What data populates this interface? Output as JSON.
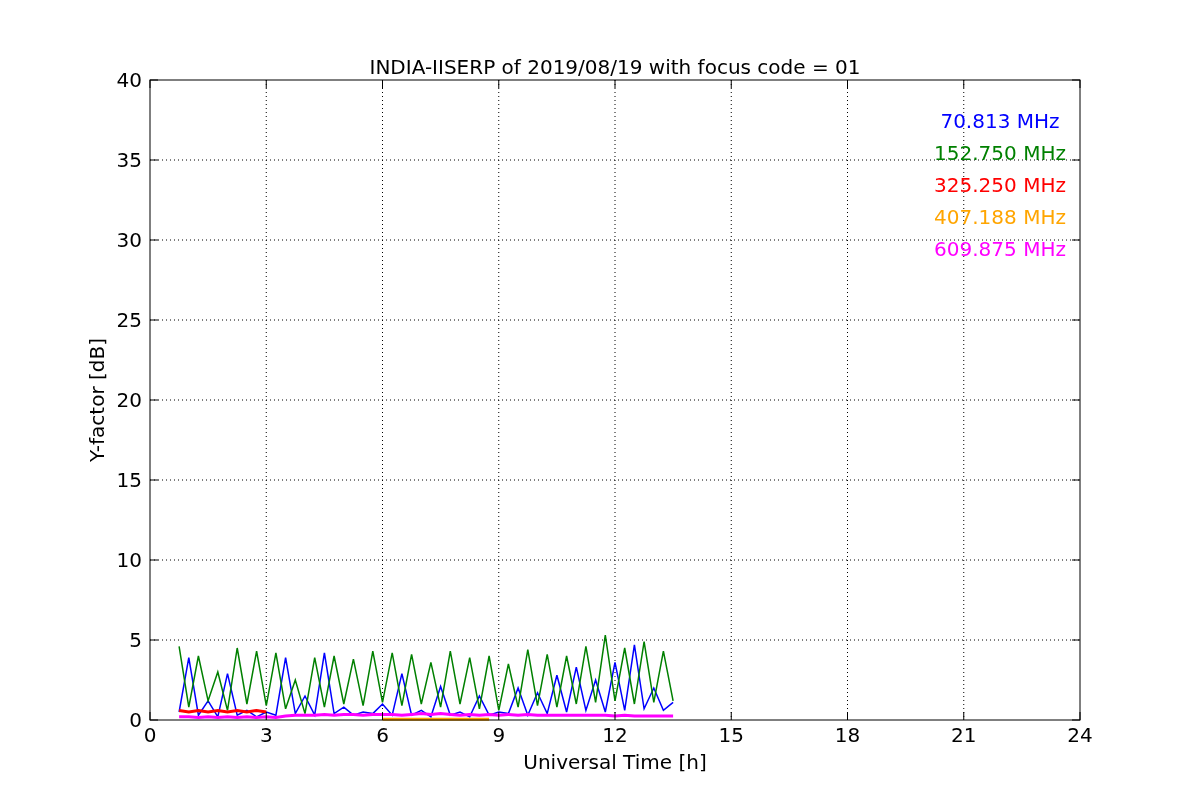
{
  "chart_data": {
    "type": "line",
    "grid": true,
    "title": "INDIA-IISERP of 2019/08/19 with focus code = 01",
    "xlabel": "Universal Time [h]",
    "ylabel": "Y-factor [dB]",
    "xlim": [
      0,
      24
    ],
    "ylim": [
      0,
      40
    ],
    "xticks": [
      0,
      3,
      6,
      9,
      12,
      15,
      18,
      21,
      24
    ],
    "yticks": [
      0,
      5,
      10,
      15,
      20,
      25,
      30,
      35,
      40
    ],
    "x": [
      0.75,
      1,
      1.25,
      1.5,
      1.75,
      2,
      2.25,
      2.5,
      2.75,
      3,
      3.25,
      3.5,
      3.75,
      4,
      4.25,
      4.5,
      4.75,
      5,
      5.25,
      5.5,
      5.75,
      6,
      6.25,
      6.5,
      6.75,
      7,
      7.25,
      7.5,
      7.75,
      8,
      8.25,
      8.5,
      8.75,
      9,
      9.25,
      9.5,
      9.75,
      10,
      10.25,
      10.5,
      10.75,
      11,
      11.25,
      11.5,
      11.75,
      12,
      12.25,
      12.5,
      12.75,
      13,
      13.25,
      13.5
    ],
    "series": [
      {
        "name": "70.813 MHz",
        "color": "#0000ff",
        "values": [
          0.5,
          3.9,
          0.3,
          1.2,
          0.2,
          2.9,
          0.3,
          0.6,
          0.2,
          0.5,
          0.3,
          3.9,
          0.4,
          1.5,
          0.3,
          4.2,
          0.4,
          0.8,
          0.3,
          0.5,
          0.4,
          1.0,
          0.3,
          2.9,
          0.3,
          0.6,
          0.2,
          2.1,
          0.3,
          0.5,
          0.2,
          1.5,
          0.3,
          0.5,
          0.4,
          2.0,
          0.3,
          1.7,
          0.4,
          2.8,
          0.5,
          3.3,
          0.6,
          2.5,
          0.5,
          3.6,
          0.6,
          4.7,
          0.7,
          2.0,
          0.6,
          1.1
        ]
      },
      {
        "name": "152.750 MHz",
        "color": "#008000",
        "values": [
          4.6,
          0.8,
          4.0,
          1.2,
          3.0,
          0.6,
          4.5,
          1.0,
          4.3,
          0.9,
          4.2,
          0.7,
          2.5,
          0.4,
          3.9,
          0.8,
          4.0,
          1.0,
          3.8,
          0.9,
          4.3,
          1.1,
          4.2,
          0.9,
          4.1,
          1.0,
          3.6,
          0.8,
          4.3,
          1.0,
          3.9,
          0.7,
          4.0,
          0.6,
          3.5,
          0.8,
          4.4,
          0.9,
          4.1,
          0.8,
          4.0,
          1.0,
          4.6,
          1.1,
          5.3,
          1.2,
          4.5,
          1.0,
          4.9,
          1.1,
          4.3,
          1.2
        ]
      },
      {
        "name": "325.250 MHz",
        "color": "#ff0000",
        "values": [
          0.6,
          0.5,
          0.6,
          0.5,
          0.6,
          0.5,
          0.6,
          0.5,
          0.6,
          0.5,
          null,
          null,
          null,
          null,
          null,
          null,
          null,
          null,
          null,
          null,
          null,
          null,
          null,
          null,
          null,
          null,
          null,
          null,
          null,
          null,
          null,
          null,
          null,
          null,
          null,
          null,
          null,
          null,
          null,
          null,
          null,
          null,
          null,
          null,
          null,
          null,
          null,
          null,
          null,
          null,
          null,
          null
        ]
      },
      {
        "name": "407.188 MHz",
        "color": "#ffa500",
        "values": [
          null,
          null,
          null,
          null,
          null,
          null,
          null,
          null,
          null,
          null,
          null,
          null,
          null,
          null,
          null,
          null,
          null,
          null,
          null,
          null,
          null,
          0.05,
          0.05,
          0.05,
          0.05,
          0.05,
          0.05,
          0.05,
          0.05,
          0.05,
          0.05,
          0.05,
          0.05,
          null,
          null,
          null,
          null,
          null,
          null,
          null,
          null,
          null,
          null,
          null,
          null,
          null,
          null,
          null,
          null,
          null,
          null,
          null
        ]
      },
      {
        "name": "609.875 MHz",
        "color": "#ff00ff",
        "values": [
          0.2,
          0.2,
          0.15,
          0.2,
          0.15,
          0.2,
          0.15,
          0.2,
          0.15,
          0.2,
          0.15,
          0.25,
          0.3,
          0.3,
          0.3,
          0.35,
          0.3,
          0.35,
          0.35,
          0.3,
          0.35,
          0.35,
          0.35,
          0.3,
          0.35,
          0.4,
          0.35,
          0.4,
          0.35,
          0.3,
          0.35,
          0.3,
          0.35,
          0.3,
          0.35,
          0.3,
          0.35,
          0.3,
          0.3,
          0.3,
          0.3,
          0.3,
          0.3,
          0.3,
          0.3,
          0.25,
          0.3,
          0.25,
          0.25,
          0.25,
          0.25,
          0.25
        ]
      }
    ]
  }
}
